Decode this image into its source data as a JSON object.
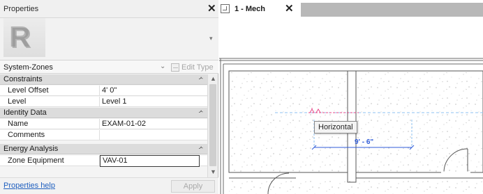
{
  "properties_panel": {
    "title": "Properties",
    "close_icon": "close-icon",
    "type_image_icon": "revit-r-logo-icon",
    "type_selector": {
      "value": "System-Zones",
      "edit_type_label": "Edit Type"
    },
    "groups": [
      {
        "label": "Constraints",
        "rows": [
          {
            "name": "Level Offset",
            "value": "4'  0\""
          },
          {
            "name": "Level",
            "value": "Level 1"
          }
        ]
      },
      {
        "label": "Identity Data",
        "rows": [
          {
            "name": "Name",
            "value": "EXAM-01-02"
          },
          {
            "name": "Comments",
            "value": ""
          }
        ]
      },
      {
        "label": "Energy Analysis",
        "rows": [
          {
            "name": "Zone Equipment",
            "value": "VAV-01"
          }
        ]
      }
    ],
    "help_link": "Properties help",
    "apply_label": "Apply"
  },
  "view_tabs": {
    "active_tab": "1 - Mech",
    "tab_icon": "floor-plan-view-icon"
  },
  "canvas": {
    "tooltip": "Horizontal",
    "dimension_text": "9' - 6\"",
    "colors": {
      "dimension_blue": "#2f5bd8",
      "align_line_blue": "#8ec0f0",
      "align_line_pink": "#e64a8a",
      "wall_line": "#555555"
    }
  }
}
